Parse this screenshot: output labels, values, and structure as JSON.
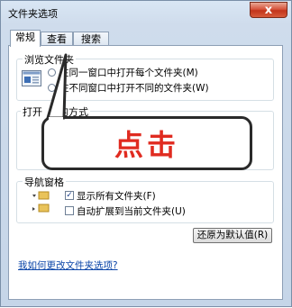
{
  "window": {
    "title": "文件夹选项",
    "close_symbol": "x"
  },
  "tabs": [
    {
      "label": "常规",
      "active": true
    },
    {
      "label": "查看",
      "active": false
    },
    {
      "label": "搜索",
      "active": false
    }
  ],
  "browse_group": {
    "title": "浏览文件夹",
    "options": [
      {
        "label": "在同一窗口中打开每个文件夹(M)",
        "checked": false
      },
      {
        "label": "在不同窗口中打开不同的文件夹(W)",
        "checked": false
      }
    ]
  },
  "open_group": {
    "title_left": "打开",
    "title_right": "的方式"
  },
  "callout": {
    "text": "点击",
    "text_color": "#e02b20"
  },
  "nav_group": {
    "title": "导航窗格",
    "options": [
      {
        "label": "显示所有文件夹(F)",
        "checked": true
      },
      {
        "label": "自动扩展到当前文件夹(U)",
        "checked": false
      }
    ]
  },
  "restore_button": {
    "label": "还原为默认值(R)"
  },
  "help_link": {
    "label": "我如何更改文件夹选项?"
  }
}
